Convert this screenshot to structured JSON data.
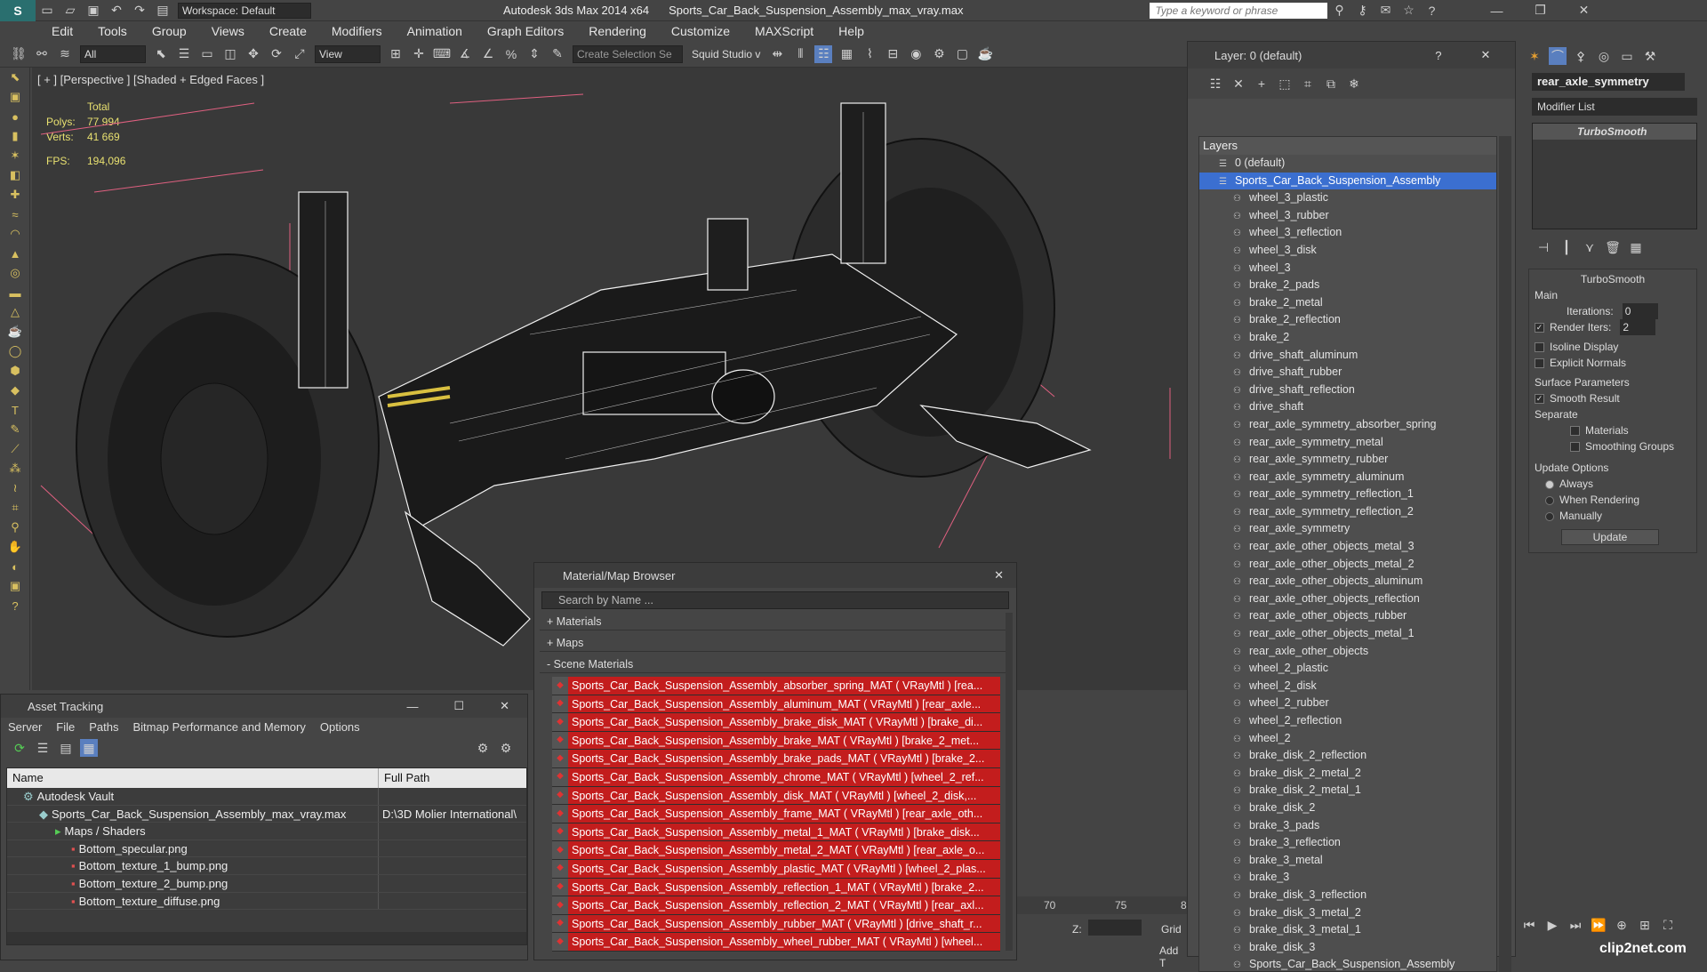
{
  "app": {
    "title": "Autodesk 3ds Max  2014 x64",
    "file": "Sports_Car_Back_Suspension_Assembly_max_vray.max",
    "workspace": "Workspace: Default",
    "search_placeholder": "Type a keyword or phrase"
  },
  "menu": [
    "Edit",
    "Tools",
    "Group",
    "Views",
    "Create",
    "Modifiers",
    "Animation",
    "Graph Editors",
    "Rendering",
    "Customize",
    "MAXScript",
    "Help"
  ],
  "toolbar": {
    "filter": "All",
    "view": "View",
    "selection_set": "Create Selection Se",
    "squid": "Squid Studio v"
  },
  "viewport": {
    "label": "[ + ] [Perspective ] [Shaded + Edged Faces ]",
    "stats": {
      "total_label": "Total",
      "polys_label": "Polys:",
      "polys": "77 994",
      "verts_label": "Verts:",
      "verts": "41 669",
      "fps_label": "FPS:",
      "fps": "194,096"
    }
  },
  "layers": {
    "title": "Layer: 0 (default)",
    "header": "Layers",
    "default": "0 (default)",
    "selected": "Sports_Car_Back_Suspension_Assembly",
    "items": [
      "wheel_3_plastic",
      "wheel_3_rubber",
      "wheel_3_reflection",
      "wheel_3_disk",
      "wheel_3",
      "brake_2_pads",
      "brake_2_metal",
      "brake_2_reflection",
      "brake_2",
      "drive_shaft_aluminum",
      "drive_shaft_rubber",
      "drive_shaft_reflection",
      "drive_shaft",
      "rear_axle_symmetry_absorber_spring",
      "rear_axle_symmetry_metal",
      "rear_axle_symmetry_rubber",
      "rear_axle_symmetry_aluminum",
      "rear_axle_symmetry_reflection_1",
      "rear_axle_symmetry_reflection_2",
      "rear_axle_symmetry",
      "rear_axle_other_objects_metal_3",
      "rear_axle_other_objects_metal_2",
      "rear_axle_other_objects_aluminum",
      "rear_axle_other_objects_reflection",
      "rear_axle_other_objects_rubber",
      "rear_axle_other_objects_metal_1",
      "rear_axle_other_objects",
      "wheel_2_plastic",
      "wheel_2_disk",
      "wheel_2_rubber",
      "wheel_2_reflection",
      "wheel_2",
      "brake_disk_2_reflection",
      "brake_disk_2_metal_2",
      "brake_disk_2_metal_1",
      "brake_disk_2",
      "brake_3_pads",
      "brake_3_reflection",
      "brake_3_metal",
      "brake_3",
      "brake_disk_3_reflection",
      "brake_disk_3_metal_2",
      "brake_disk_3_metal_1",
      "brake_disk_3",
      "Sports_Car_Back_Suspension_Assembly"
    ]
  },
  "command_panel": {
    "object_name": "rear_axle_symmetry",
    "modifier_list": "Modifier List",
    "stack_item": "TurboSmooth",
    "rollout": "TurboSmooth",
    "main": "Main",
    "iterations_label": "Iterations:",
    "iterations": "0",
    "render_iters_label": "Render Iters:",
    "render_iters": "2",
    "isoline": "Isoline Display",
    "explicit": "Explicit Normals",
    "surface": "Surface Parameters",
    "smooth_result": "Smooth Result",
    "separate": "Separate",
    "materials": "Materials",
    "smoothing_groups": "Smoothing Groups",
    "update_options": "Update Options",
    "always": "Always",
    "when_rendering": "When Rendering",
    "manually": "Manually",
    "update": "Update"
  },
  "material_browser": {
    "title": "Material/Map Browser",
    "search": "Search by Name ...",
    "sections": [
      "+ Materials",
      "+ Maps",
      "- Scene Materials"
    ],
    "rows": [
      {
        "name": "Sports_Car_Back_Suspension_Assembly_absorber_spring_MAT ( VRayMtl ) [rea..."
      },
      {
        "name": "Sports_Car_Back_Suspension_Assembly_aluminum_MAT ( VRayMtl ) [rear_axle..."
      },
      {
        "name": "Sports_Car_Back_Suspension_Assembly_brake_disk_MAT ( VRayMtl ) [brake_di..."
      },
      {
        "name": "Sports_Car_Back_Suspension_Assembly_brake_MAT ( VRayMtl ) [brake_2_met..."
      },
      {
        "name": "Sports_Car_Back_Suspension_Assembly_brake_pads_MAT ( VRayMtl ) [brake_2..."
      },
      {
        "name": "Sports_Car_Back_Suspension_Assembly_chrome_MAT ( VRayMtl ) [wheel_2_ref..."
      },
      {
        "name": "Sports_Car_Back_Suspension_Assembly_disk_MAT ( VRayMtl ) [wheel_2_disk,..."
      },
      {
        "name": "Sports_Car_Back_Suspension_Assembly_frame_MAT ( VRayMtl ) [rear_axle_oth..."
      },
      {
        "name": "Sports_Car_Back_Suspension_Assembly_metal_1_MAT ( VRayMtl ) [brake_disk..."
      },
      {
        "name": "Sports_Car_Back_Suspension_Assembly_metal_2_MAT ( VRayMtl ) [rear_axle_o..."
      },
      {
        "name": "Sports_Car_Back_Suspension_Assembly_plastic_MAT ( VRayMtl ) [wheel_2_plas..."
      },
      {
        "name": "Sports_Car_Back_Suspension_Assembly_reflection_1_MAT ( VRayMtl ) [brake_2..."
      },
      {
        "name": "Sports_Car_Back_Suspension_Assembly_reflection_2_MAT ( VRayMtl ) [rear_axl..."
      },
      {
        "name": "Sports_Car_Back_Suspension_Assembly_rubber_MAT ( VRayMtl ) [drive_shaft_r..."
      },
      {
        "name": "Sports_Car_Back_Suspension_Assembly_wheel_rubber_MAT ( VRayMtl ) [wheel..."
      }
    ]
  },
  "asset_tracking": {
    "title": "Asset Tracking",
    "menu": [
      "Server",
      "File",
      "Paths",
      "Bitmap Performance and Memory",
      "Options"
    ],
    "col_name": "Name",
    "col_path": "Full Path",
    "rows": [
      {
        "name": "Autodesk Vault",
        "path": "",
        "indent": 1
      },
      {
        "name": "Sports_Car_Back_Suspension_Assembly_max_vray.max",
        "path": "D:\\3D Molier International\\",
        "indent": 2
      },
      {
        "name": "Maps / Shaders",
        "path": "",
        "indent": 3
      },
      {
        "name": "Bottom_specular.png",
        "path": "",
        "indent": 4
      },
      {
        "name": "Bottom_texture_1_bump.png",
        "path": "",
        "indent": 4
      },
      {
        "name": "Bottom_texture_2_bump.png",
        "path": "",
        "indent": 4
      },
      {
        "name": "Bottom_texture_diffuse.png",
        "path": "",
        "indent": 4
      }
    ]
  },
  "timeline": {
    "ticks": [
      "70",
      "75",
      "8"
    ],
    "z_label": "Z:",
    "grid": "Grid",
    "add": "Add T"
  },
  "watermark": "clip2net.com"
}
